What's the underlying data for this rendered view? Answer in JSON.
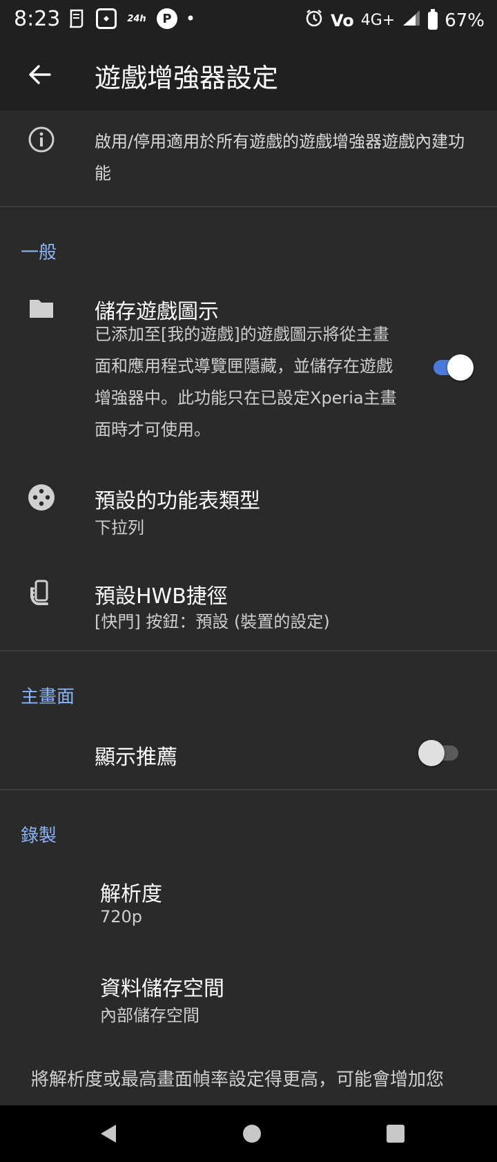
{
  "status": {
    "time": "8:23",
    "network": "4G+",
    "volte": "Vo",
    "battery": "67%",
    "icons": [
      "receipt-icon",
      "app-icon",
      "24h-icon",
      "pinterest-icon",
      "dot-icon",
      "alarm-icon",
      "wifi-calling-icon",
      "signal-icon",
      "battery-icon"
    ],
    "badge_24h": "24h",
    "pin_letter": "P"
  },
  "appbar": {
    "title": "遊戲增強器設定",
    "back_icon": "arrow-back-icon"
  },
  "info": {
    "text": "啟用/停用適用於所有遊戲的遊戲增強器遊戲內建功能",
    "icon": "info-icon"
  },
  "sections": {
    "general": {
      "header": "一般",
      "save_icons": {
        "title": "儲存遊戲圖示",
        "summary": "已添加至[我的遊戲]的遊戲圖示將從主畫面和應用程式導覽匣隱藏，並儲存在遊戲增強器中。此功能只在已設定Xperia主畫面時才可使用。",
        "enabled": true,
        "icon": "folder-icon"
      },
      "menu_type": {
        "title": "預設的功能表類型",
        "summary": "下拉列",
        "icon": "gamepad-icon"
      },
      "hwb_shortcut": {
        "title": "預設HWB捷徑",
        "summary": "[快門] 按鈕：預設 (裝置的設定)",
        "icon": "phone-hand-icon"
      }
    },
    "home": {
      "header": "主畫面",
      "show_recommend": {
        "title": "顯示推薦",
        "enabled": false
      }
    },
    "recording": {
      "header": "錄製",
      "resolution": {
        "title": "解析度",
        "summary": "720p"
      },
      "storage": {
        "title": "資料儲存空間",
        "summary": "內部儲存空間"
      }
    }
  },
  "footer_note": "將解析度或最高畫面幀率設定得更高，可能會增加您",
  "nav": {
    "back": "nav-back-icon",
    "home": "nav-home-icon",
    "recents": "nav-recents-icon"
  },
  "colors": {
    "accent": "#8ab4f8",
    "switch_on": "#4a7bd8",
    "background": "#2a2a2a",
    "appbar": "#202020"
  }
}
